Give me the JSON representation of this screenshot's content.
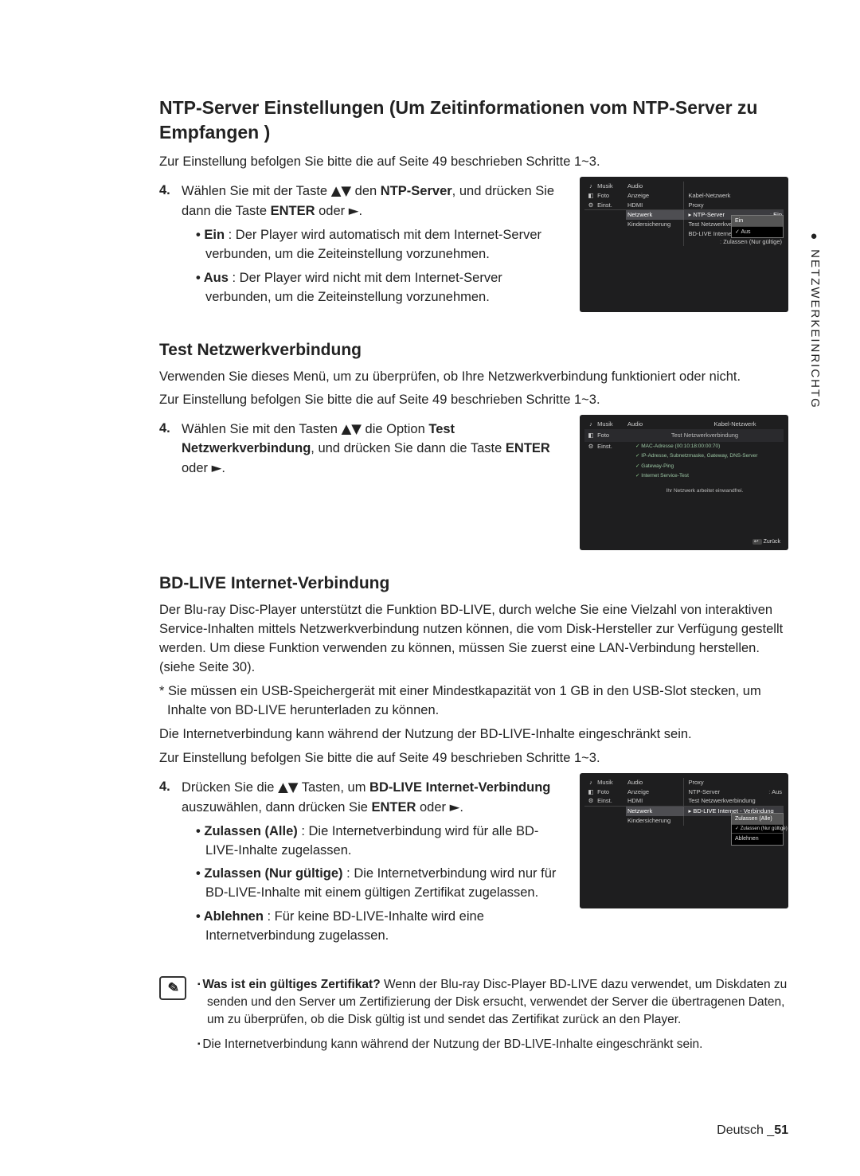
{
  "sidetab": {
    "text": "NETZWERKEINRICHTG"
  },
  "section1": {
    "heading": "NTP-Server Einstellungen (Um Zeitinformationen vom NTP-Server zu Empfangen )",
    "lead": "Zur Einstellung befolgen Sie bitte die auf Seite 49 beschrieben Schritte 1~3.",
    "step_num": "4.",
    "step_text_a": "Wählen Sie mit der Taste ",
    "step_text_b": " den ",
    "step_bold": "NTP-Server",
    "step_text_c": ", und drücken Sie dann die Taste ",
    "step_bold2": "ENTER",
    "step_text_d": " oder ",
    "ein_label": "Ein",
    "ein_text": " : Der Player wird automatisch mit dem Internet-Server verbunden, um die Zeiteinstellung vorzunehmen.",
    "aus_label": "Aus",
    "aus_text": " : Der Player wird nicht mit dem Internet-Server verbunden, um die Zeiteinstellung vorzunehmen."
  },
  "osd1": {
    "side": [
      "Musik",
      "Foto",
      "Einst."
    ],
    "mid": [
      "Audio",
      "Anzeige",
      "HDMI",
      "Netzwerk",
      "Kindersicherung"
    ],
    "right": [
      "Kabel-Netzwerk",
      "Proxy",
      "NTP-Server",
      "Test Netzwerkverbindung",
      "BD-LIVE Internet - Verbindung"
    ],
    "ntp_val": "Ein",
    "bd_val": "Zulassen (Nur gültige)",
    "popup": [
      "Ein",
      "Aus"
    ]
  },
  "section2": {
    "heading": "Test Netzwerkverbindung",
    "lead1": "Verwenden Sie dieses Menü, um zu überprüfen, ob Ihre Netzwerkverbindung funktioniert oder nicht.",
    "lead2": "Zur Einstellung befolgen Sie bitte die auf Seite 49 beschrieben Schritte 1~3.",
    "step_num": "4.",
    "step_a": "Wählen Sie mit den Tasten ",
    "step_b": " die Option ",
    "step_bold1": "Test Netzwerkverbindung",
    "step_c": ", und drücken Sie dann die Taste ",
    "step_bold2": "ENTER",
    "step_d": " oder "
  },
  "osd2": {
    "side": [
      "Musik",
      "Foto",
      "Einst."
    ],
    "mid_top": "Audio",
    "mid_header": "Kabel-Netzwerk",
    "sub_header": "Test Netzwerkverbindung",
    "status": [
      "MAC-Adresse (00:10:18:00:00:70)",
      "IP-Adresse, Subnetzmaske, Gateway, DNS-Server",
      "Gateway-Ping",
      "Internet Service-Test"
    ],
    "msg": "Ihr Netzwerk arbeitet einwandfrei.",
    "back": "Zurück"
  },
  "section3": {
    "heading": "BD-LIVE Internet-Verbindung",
    "p1": "Der Blu-ray Disc-Player unterstützt die Funktion BD-LIVE, durch welche Sie eine Vielzahl von interaktiven Service-Inhalten mittels Netzwerkverbindung nutzen können, die vom Disk-Hersteller zur Verfügung gestellt werden. Um diese Funktion verwenden zu können, müssen Sie zuerst eine LAN-Verbindung herstellen. (siehe Seite 30).",
    "star": "* Sie müssen ein USB-Speichergerät mit einer Mindestkapazität von 1 GB in den USB-Slot stecken, um Inhalte von BD-LIVE herunterladen zu können.",
    "p2": "Die Internetverbindung kann während der Nutzung der BD-LIVE-Inhalte eingeschränkt sein.",
    "p3": "Zur Einstellung befolgen Sie bitte die auf Seite 49 beschrieben Schritte 1~3.",
    "step_num": "4.",
    "step_a": "Drücken Sie die ",
    "step_b": " Tasten, um ",
    "step_bold1": "BD-LIVE Internet-Verbindung",
    "step_c": " auszuwählen, dann drücken Sie ",
    "step_bold2": "ENTER",
    "step_d": " oder ",
    "opt1_l": "Zulassen (Alle)",
    "opt1_t": " : Die Internetverbindung wird für alle BD-LIVE-Inhalte zugelassen.",
    "opt2_l": "Zulassen (Nur gültige)",
    "opt2_t": " : Die Internetverbindung wird nur für BD-LIVE-Inhalte mit einem gültigen Zertifikat zugelassen.",
    "opt3_l": "Ablehnen",
    "opt3_t": " : Für keine BD-LIVE-Inhalte wird eine Internetverbindung zugelassen."
  },
  "osd3": {
    "side": [
      "Musik",
      "Foto",
      "Einst."
    ],
    "mid": [
      "Audio",
      "Anzeige",
      "HDMI",
      "Netzwerk",
      "Kindersicherung"
    ],
    "right": [
      "Proxy",
      "NTP-Server",
      "Test Netzwerkverbindung",
      "BD-LIVE Internet - Verbindung"
    ],
    "ntp_val": "Aus",
    "popup": [
      "Zulassen (Alle)",
      "Zulassen (Nur gültige)",
      "Ablehnen"
    ]
  },
  "notes": {
    "n1a": "Was ist ein gültiges Zertifikat?",
    "n1b": " Wenn der Blu-ray Disc-Player BD-LIVE dazu verwendet, um Diskdaten zu senden und den Server um Zertifizierung der Disk ersucht, verwendet der Server die übertragenen Daten, um zu überprüfen, ob die Disk gültig ist und sendet das Zertifikat zurück an den Player.",
    "n2": "Die Internetverbindung kann während der Nutzung der BD-LIVE-Inhalte eingeschränkt sein."
  },
  "footer": {
    "lang": "Deutsch _",
    "page": "51"
  }
}
